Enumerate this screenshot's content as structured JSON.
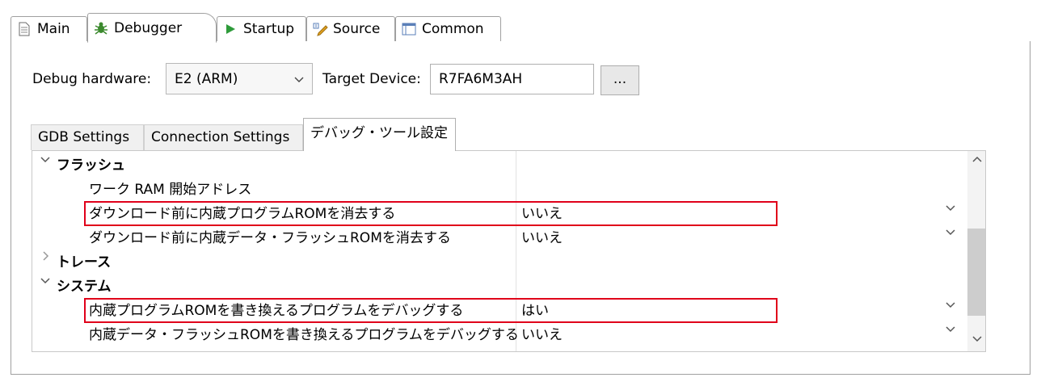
{
  "top_tabs": [
    {
      "label": "Main",
      "icon": "document-icon"
    },
    {
      "label": "Debugger",
      "icon": "bug-icon"
    },
    {
      "label": "Startup",
      "icon": "play-icon"
    },
    {
      "label": "Source",
      "icon": "source-icon"
    },
    {
      "label": "Common",
      "icon": "window-icon"
    }
  ],
  "debug_hardware": {
    "label": "Debug hardware:",
    "value": "E2 (ARM)"
  },
  "target_device": {
    "label": "Target Device:",
    "value": "R7FA6M3AH",
    "browse_label": "..."
  },
  "inner_tabs": [
    "GDB Settings",
    "Connection Settings",
    "デバッグ・ツール設定"
  ],
  "properties": {
    "flash": {
      "label": "フラッシュ",
      "items": [
        {
          "name": "ワーク RAM 開始アドレス",
          "value": ""
        },
        {
          "name": "ダウンロード前に内蔵プログラムROMを消去する",
          "value": "いいえ"
        },
        {
          "name": "ダウンロード前に内蔵データ・フラッシュROMを消去する",
          "value": "いいえ"
        }
      ]
    },
    "trace": {
      "label": "トレース"
    },
    "system": {
      "label": "システム",
      "items": [
        {
          "name": "内蔵プログラムROMを書き換えるプログラムをデバッグする",
          "value": "はい"
        },
        {
          "name": "内蔵データ・フラッシュROMを書き換えるプログラムをデバッグする",
          "value": "いいえ"
        }
      ]
    }
  },
  "colors": {
    "highlight": "#e0001a",
    "bug_icon": "#3c8a2e",
    "play_icon": "#2e9b3a"
  }
}
